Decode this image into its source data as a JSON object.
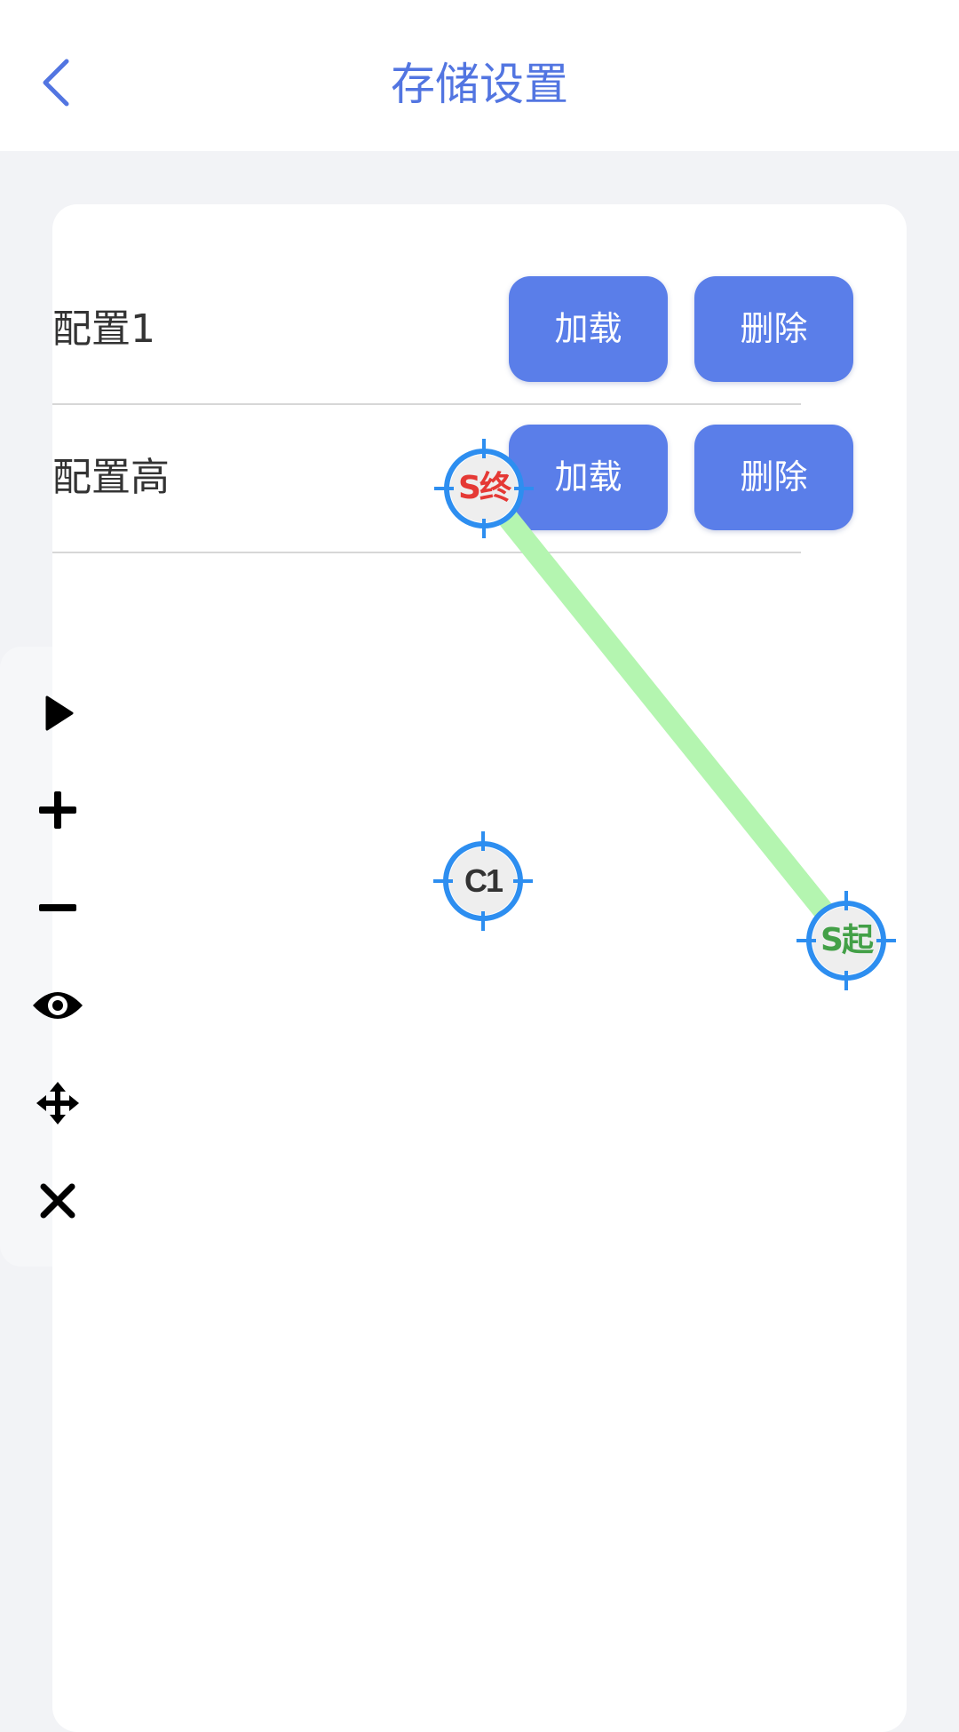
{
  "header": {
    "title": "存储设置"
  },
  "configs": [
    {
      "name": "配置1",
      "load_label": "加载",
      "delete_label": "删除"
    },
    {
      "name": "配置高",
      "load_label": "加载",
      "delete_label": "删除"
    }
  ],
  "toolbar": {
    "icons": [
      "play-icon",
      "plus-icon",
      "minus-icon",
      "eye-icon",
      "move-icon",
      "close-icon"
    ]
  },
  "markers": {
    "end": {
      "label": "S终",
      "color": "#e53935"
    },
    "start": {
      "label": "S起",
      "color": "#43a047"
    },
    "center": {
      "label": "C1",
      "color": "#333333"
    }
  },
  "colors": {
    "accent": "#5a7ee9",
    "title": "#5275e1",
    "path": "#b4f5b0",
    "crosshair": "#2d8ef0"
  }
}
